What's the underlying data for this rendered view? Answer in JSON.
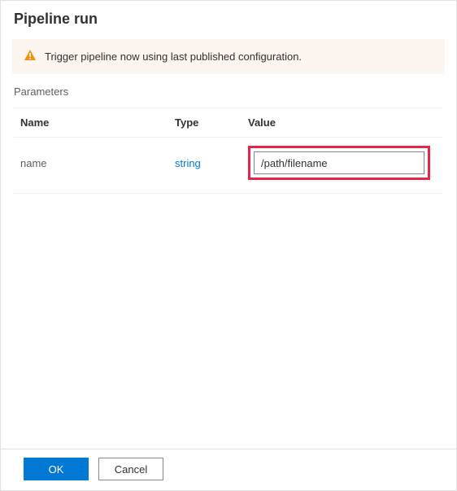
{
  "header": {
    "title": "Pipeline run"
  },
  "alert": {
    "icon": "warning-icon",
    "text": "Trigger pipeline now using last published configuration."
  },
  "parameters": {
    "section_label": "Parameters",
    "columns": {
      "name": "Name",
      "type": "Type",
      "value": "Value"
    },
    "rows": [
      {
        "name": "name",
        "type": "string",
        "value": "/path/filename"
      }
    ]
  },
  "footer": {
    "ok_label": "OK",
    "cancel_label": "Cancel"
  }
}
